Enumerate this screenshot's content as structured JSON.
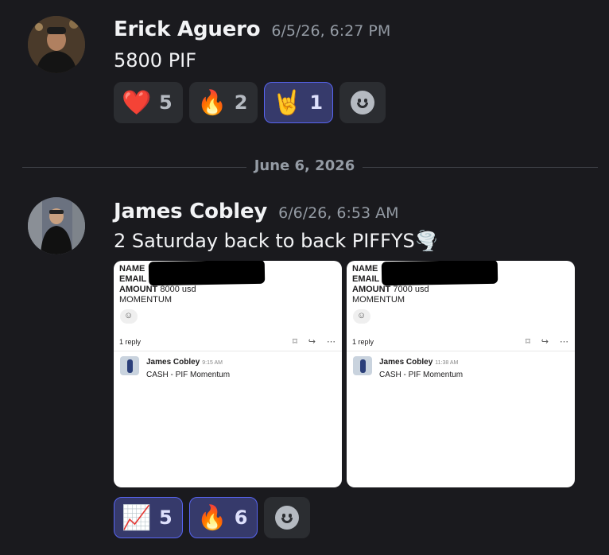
{
  "messages": [
    {
      "username": "Erick Aguero",
      "timestamp": "6/5/26, 6:27 PM",
      "content": "5800 PIF",
      "reactions": [
        {
          "emoji": "❤️",
          "icon": "heart",
          "count": "5",
          "me": false
        },
        {
          "emoji": "🔥",
          "icon": "fire",
          "count": "2",
          "me": false
        },
        {
          "emoji": "🤘",
          "icon": "rock-on-hand",
          "count": "1",
          "me": true
        }
      ]
    },
    {
      "username": "James Cobley",
      "timestamp": "6/6/26, 6:53 AM",
      "content": "2 Saturday back to back PIFFYS🌪️",
      "reactions": [
        {
          "emoji": "📈",
          "icon": "chart-increasing",
          "count": "5",
          "me": true
        },
        {
          "emoji": "🔥",
          "icon": "fire",
          "count": "6",
          "me": true
        }
      ],
      "attachments": [
        {
          "name_label": "NAME",
          "email_label": "EMAIL",
          "amount_label": "AMOUNT",
          "amount_value": "8000 usd",
          "program": "MOMENTUM",
          "thread_replies": "1 reply",
          "reply_author": "James Cobley",
          "reply_time": "9:15 AM",
          "reply_text": "CASH - PIF Momentum"
        },
        {
          "name_label": "NAME",
          "email_label": "EMAIL",
          "amount_label": "AMOUNT",
          "amount_value": "7000 usd",
          "program": "MOMENTUM",
          "thread_replies": "1 reply",
          "reply_author": "James Cobley",
          "reply_time": "11:38 AM",
          "reply_text": "CASH - PIF Momentum"
        }
      ]
    }
  ],
  "divider": {
    "label": "June 6, 2026"
  }
}
